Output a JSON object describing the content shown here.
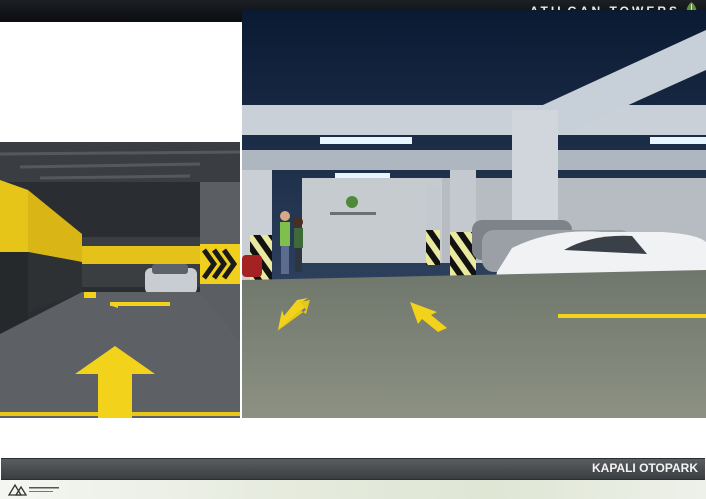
{
  "header": {
    "brand_text": "ATILGAN TOWERS",
    "logo_icon": "leaf-logo-icon"
  },
  "images": {
    "left": "parking-garage-entrance-render",
    "right": "parking-garage-interior-render"
  },
  "caption": {
    "text": "KAPALI OTOPARK"
  },
  "footer": {
    "logo_icon": "company-logo-icon"
  },
  "colors": {
    "accent_yellow": "#f2d21a",
    "dark_bar": "#15181b",
    "caption_bar": "#4a4d50"
  }
}
